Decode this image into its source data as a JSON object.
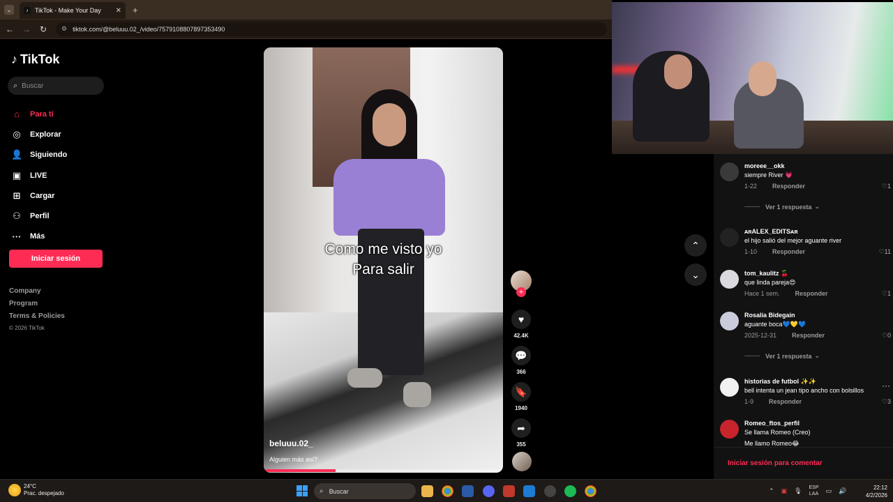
{
  "browser": {
    "tab_title": "TikTok - Make Your Day",
    "tab_favicon": "tiktok-icon",
    "url": "tiktok.com/@beluuu.02_/video/7579108807897353490"
  },
  "sidebar": {
    "logo_text": "TikTok",
    "search_placeholder": "Buscar",
    "nav": [
      {
        "label": "Para ti",
        "icon": "home-icon",
        "active": true
      },
      {
        "label": "Explorar",
        "icon": "compass-icon"
      },
      {
        "label": "Siguiendo",
        "icon": "person-icon"
      },
      {
        "label": "LIVE",
        "icon": "live-icon"
      },
      {
        "label": "Cargar",
        "icon": "upload-icon"
      },
      {
        "label": "Perfil",
        "icon": "profile-icon"
      },
      {
        "label": "Más",
        "icon": "more-icon"
      }
    ],
    "login_button": "Iniciar sesión",
    "footer": {
      "company": "Company",
      "program": "Program",
      "terms": "Terms & Policies",
      "copyright": "© 2026 TikTok"
    }
  },
  "video": {
    "overlay_line1": "Como me visto yo",
    "overlay_line2": "Para salir",
    "username": "beluuu.02_",
    "description": "Alguien más así?",
    "progress_fraction": 0.3
  },
  "actions": {
    "likes": "42.4K",
    "comments": "366",
    "saves": "1940",
    "shares": "355"
  },
  "comments": [
    {
      "name": "moreee__okk",
      "text": "siempre River 💗",
      "date": "1-22",
      "reply": "Responder",
      "likes": "1",
      "replies_label": "Ver 1 respuesta"
    },
    {
      "name": "ᴀʀALEX_EDITSᴀʀ",
      "text": "el hijo salió del mejor aguante river",
      "date": "1-10",
      "reply": "Responder",
      "likes": "11"
    },
    {
      "name": "tom_kaulitz 🍒",
      "text": "que linda pareja😍",
      "date": "Hace 1 sem.",
      "reply": "Responder",
      "likes": "1"
    },
    {
      "name": "Rosalía Bidegain",
      "text": "aguante boca💙💛💙",
      "date": "2025-12-31",
      "reply": "Responder",
      "likes": "0",
      "replies_label": "Ver 1 respuesta"
    },
    {
      "name": "historias de futbol ✨✨",
      "text": "bell intenta un jean tipo ancho con bolsillos",
      "date": "1-9",
      "reply": "Responder",
      "likes": "3"
    },
    {
      "name": "Romeo_ftos_perfil",
      "text": "Se llama Romeo (Creo)",
      "text2": "Me llamo Romeo😂"
    }
  ],
  "comment_login": "Iniciar sesión para comentar",
  "taskbar": {
    "temp": "24°C",
    "weather": "Prac. despejado",
    "search": "Buscar",
    "lang1": "ESP",
    "lang2": "LAA",
    "time": "22:12",
    "date": "4/2/2026"
  },
  "colors": {
    "accent": "#fe2c55",
    "comment_bg": "#121212"
  }
}
